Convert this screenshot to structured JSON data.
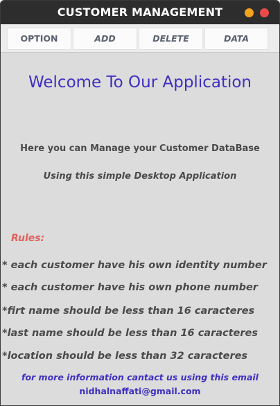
{
  "window": {
    "title": "CUSTOMER MANAGEMENT",
    "controls": {
      "minimize_color": "#f4a31d",
      "close_color": "#ec4a4a"
    }
  },
  "menu": {
    "items": [
      "OPTION",
      "ADD",
      "DELETE",
      "DATA"
    ]
  },
  "main": {
    "welcome": "Welcome To Our Application",
    "line1": "Here you can Manage your Customer DataBase",
    "line2": "Using this simple Desktop Application",
    "rules_heading": "Rules:",
    "rules": [
      "* each customer have his own identity number",
      "* each customer have his own phone number",
      "*firt name should be less than 16 caracteres",
      "*last name should be less than 16 caracteres",
      "*location should be less than 32 caracteres"
    ],
    "footer_line1": "for more information cantact us using this email",
    "footer_email": "nidhalnaffati@gmail.com"
  },
  "colors": {
    "accent_blue": "#3f2fc0",
    "rules_red": "#e0605a",
    "background": "#dcdcdc",
    "titlebar": "#2d2d2d"
  }
}
